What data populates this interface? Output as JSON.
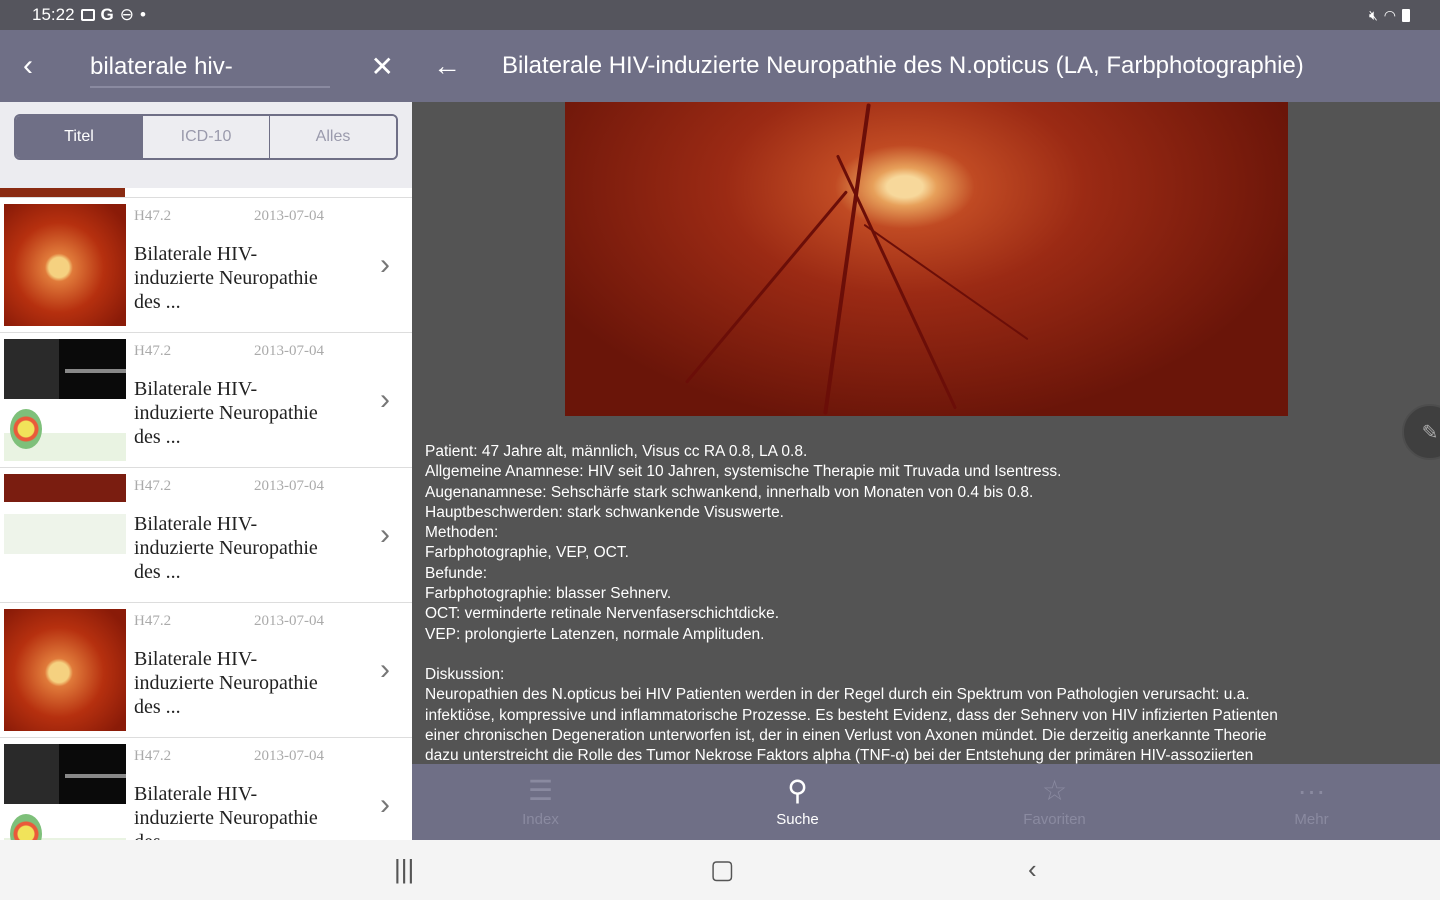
{
  "statusbar": {
    "time": "15:22",
    "left_icons": [
      "image-icon",
      "google-icon",
      "blocked-icon",
      "dot-icon"
    ],
    "right_icons": [
      "mute-icon",
      "wifi-icon",
      "battery-icon"
    ]
  },
  "search": {
    "value": "bilaterale hiv-",
    "placeholder": ""
  },
  "filters": [
    "Titel",
    "ICD-10",
    "Alles"
  ],
  "results": [
    {
      "code": "H47.2",
      "date": "2013-07-04",
      "title": "Bilaterale HIV-induzierte Neuropathie des ...",
      "thumb": "fundus"
    },
    {
      "code": "H47.2",
      "date": "2013-07-04",
      "title": "Bilaterale HIV-induzierte Neuropathie des ...",
      "thumb": "oct"
    },
    {
      "code": "H47.2",
      "date": "2013-07-04",
      "title": "Bilaterale HIV-induzierte Neuropathie des ...",
      "thumb": "multi"
    },
    {
      "code": "H47.2",
      "date": "2013-07-04",
      "title": "Bilaterale HIV-induzierte Neuropathie des ...",
      "thumb": "fundus"
    },
    {
      "code": "H47.2",
      "date": "2013-07-04",
      "title": "Bilaterale HIV-induzierte Neuropathie des ...",
      "thumb": "oct"
    }
  ],
  "detail": {
    "title": "Bilaterale HIV-induzierte Neuropathie des N.opticus (LA, Farbphotographie)",
    "lines": [
      "Patient: 47 Jahre alt, männlich, Visus cc RA 0.8, LA  0.8.",
      "Allgemeine Anamnese:  HIV seit 10 Jahren,  systemische Therapie mit  Truvada und Isentress.",
      "Augenanamnese:  Sehschärfe stark schwankend, innerhalb von Monaten von 0.4 bis  0.8.",
      "Hauptbeschwerden: stark schwankende Visuswerte.",
      "Methoden:",
      "Farbphotographie, VEP, OCT.",
      "Befunde:",
      "Farbphotographie: blasser Sehnerv.",
      "OCT: verminderte retinale Nervenfaserschichtdicke.",
      "VEP: prolongierte Latenzen, normale Amplituden.",
      "",
      "Diskussion:",
      "Neuropathien des N.opticus  bei HIV Patienten werden in der Regel durch ein Spektrum von Pathologien verursacht: u.a.",
      "infektiöse, kompressive und inflammatorische Prozesse.  Es besteht Evidenz, dass  der Sehnerv  von HIV infizierten Patienten",
      "einer  chronischen Degeneration unterworfen ist, der in einen Verlust von Axonen mündet.  Die derzeitig anerkannte Theorie",
      "dazu unterstreicht die Rolle des  Tumor Nekrose Faktors alpha (TNF-α) bei der Entstehung der primären HIV-assoziierten"
    ]
  },
  "bottomnav": [
    {
      "label": "Index",
      "icon": "list-icon",
      "active": false
    },
    {
      "label": "Suche",
      "icon": "search-icon",
      "active": true
    },
    {
      "label": "Favoriten",
      "icon": "star-icon",
      "active": false
    },
    {
      "label": "Mehr",
      "icon": "more-icon",
      "active": false
    }
  ],
  "colors": {
    "header": "#6f6f86",
    "detail_bg": "#545454",
    "list_bg": "#ffffff"
  }
}
